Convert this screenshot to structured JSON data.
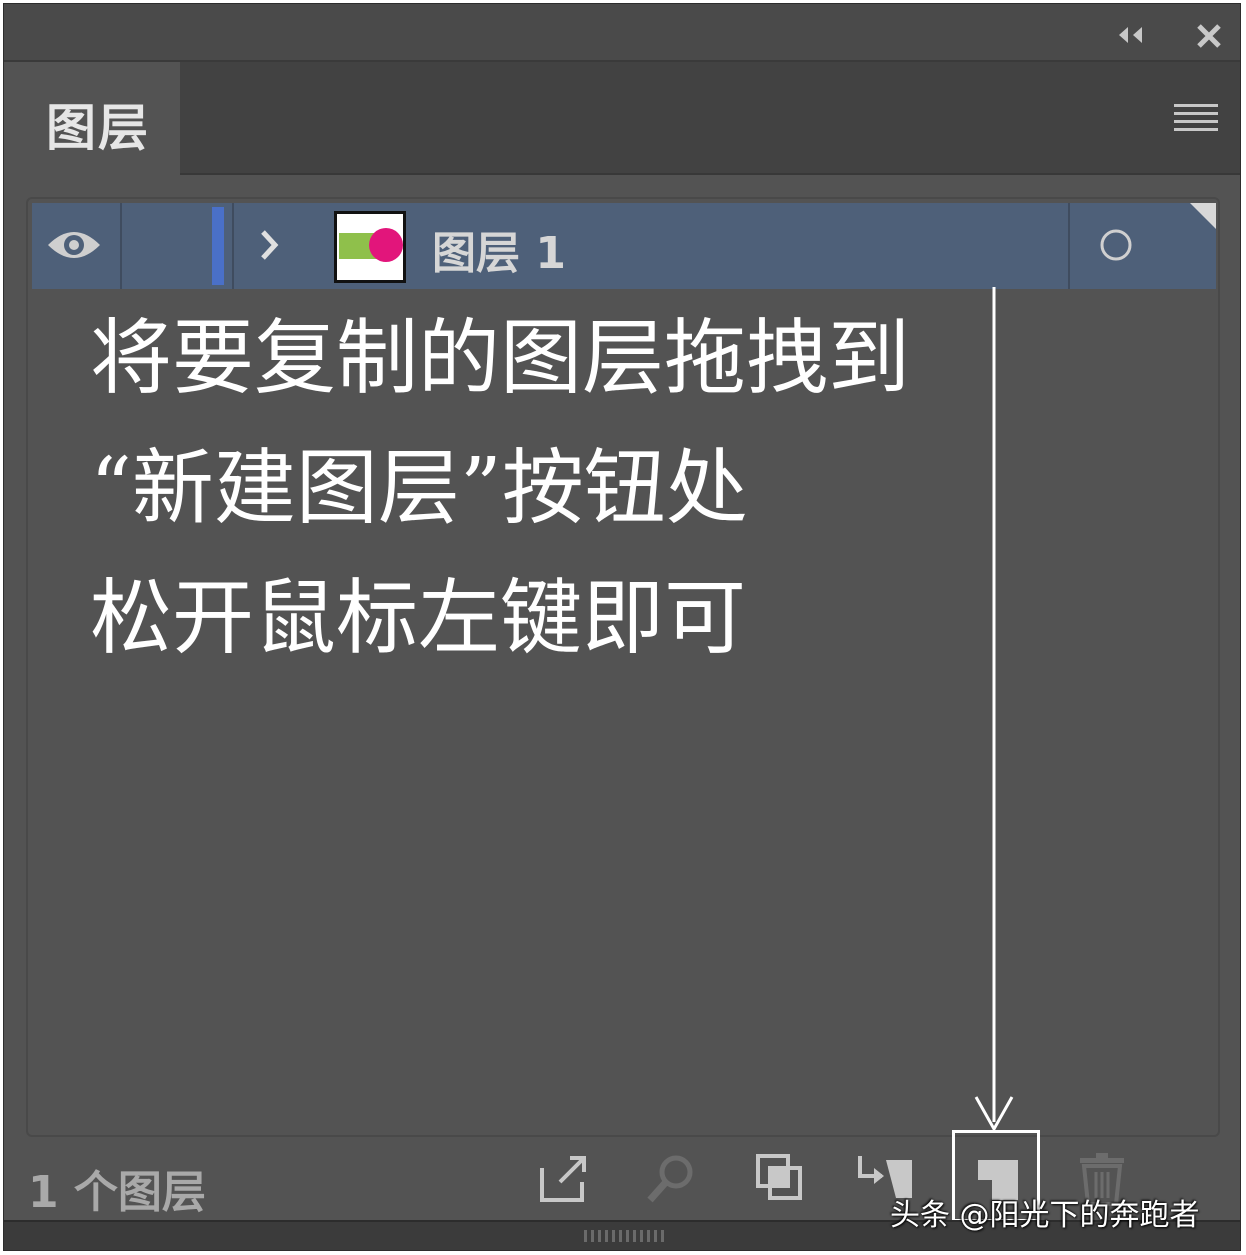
{
  "panel": {
    "tab_label": "图层",
    "controls": {
      "collapse_icon": "double-chevron-left-icon",
      "close_icon": "close-icon",
      "menu_icon": "hamburger-menu-icon"
    }
  },
  "layers": [
    {
      "name": "图层 1",
      "visible": true,
      "expanded": false,
      "color": "#4a70c8",
      "thumbnail_colors": [
        "#8fc04b",
        "#e2157b"
      ]
    }
  ],
  "instruction": {
    "lines": [
      "将要复制的图层拖拽到",
      "“新建图层”按钮处",
      "松开鼠标左键即可"
    ]
  },
  "footer": {
    "layer_count": "1 个图层",
    "buttons": [
      {
        "icon": "export-icon"
      },
      {
        "icon": "locate-object-icon"
      },
      {
        "icon": "clipping-mask-icon"
      },
      {
        "icon": "new-sublayer-icon"
      },
      {
        "icon": "new-layer-icon",
        "highlighted": true
      },
      {
        "icon": "trash-icon"
      }
    ]
  },
  "watermark": "头条 @阳光下的奔跑者"
}
